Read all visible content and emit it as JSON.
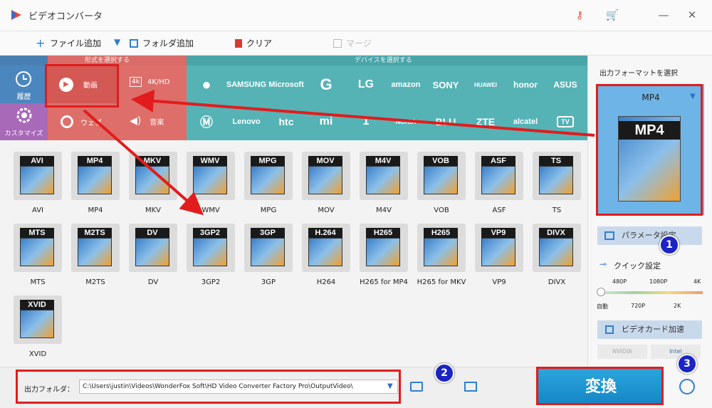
{
  "app": {
    "title": "ビデオコンバータ"
  },
  "toolbar": {
    "add_file": "ファイル追加",
    "add_folder": "フォルダ追加",
    "clear": "クリア",
    "merge": "マージ"
  },
  "categories": {
    "format_header": "形式を選択する",
    "device_header": "デバイスを選択する",
    "history": "履歴",
    "custom": "カスタマイズ",
    "video": "動画",
    "hd": "4K/HD",
    "web": "ウェブ",
    "audio": "音楽"
  },
  "brands": [
    "SAMSUNG",
    "Microsoft",
    "G",
    "LG",
    "amazon",
    "SONY",
    "HUAWEI",
    "honor",
    "ASUS",
    "Lenovo",
    "htc",
    "mi",
    "1",
    "NOKIA",
    "BLU",
    "ZTE",
    "alcatel",
    "TV"
  ],
  "formats": [
    {
      "badge": "AVI",
      "label": "AVI"
    },
    {
      "badge": "MP4",
      "label": "MP4"
    },
    {
      "badge": "MKV",
      "label": "MKV"
    },
    {
      "badge": "WMV",
      "label": "WMV"
    },
    {
      "badge": "MPG",
      "label": "MPG"
    },
    {
      "badge": "MOV",
      "label": "MOV"
    },
    {
      "badge": "M4V",
      "label": "M4V"
    },
    {
      "badge": "VOB",
      "label": "VOB"
    },
    {
      "badge": "ASF",
      "label": "ASF"
    },
    {
      "badge": "TS",
      "label": "TS"
    },
    {
      "badge": "MTS",
      "label": "MTS"
    },
    {
      "badge": "M2TS",
      "label": "M2TS"
    },
    {
      "badge": "DV",
      "label": "DV"
    },
    {
      "badge": "3GP2",
      "label": "3GP2"
    },
    {
      "badge": "3GP",
      "label": "3GP"
    },
    {
      "badge": "H.264",
      "label": "H264"
    },
    {
      "badge": "H265",
      "label": "H265 for MP4"
    },
    {
      "badge": "H265",
      "label": "H265 for MKV"
    },
    {
      "badge": "VP9",
      "label": "VP9"
    },
    {
      "badge": "DIVX",
      "label": "DIVX"
    },
    {
      "badge": "XVID",
      "label": "XVID"
    }
  ],
  "output": {
    "label": "出力フォルダ：",
    "path": "C:\\Users\\justin\\Videos\\WonderFox Soft\\HD Video Converter Factory Pro\\OutputVideo\\"
  },
  "right": {
    "title": "出力フォーマットを選択",
    "selected": "MP4",
    "badge": "MP4",
    "params": "パラメータ設定",
    "quick": "クイック設定",
    "q_top": [
      "480P",
      "1080P",
      "4K"
    ],
    "q_bottom": [
      "自動",
      "720P",
      "2K"
    ],
    "gpu": "ビデオカード加速",
    "nvidia": "NVIDIA",
    "intel": "Intel",
    "convert": "変換"
  },
  "markers": [
    "1",
    "2",
    "3"
  ]
}
